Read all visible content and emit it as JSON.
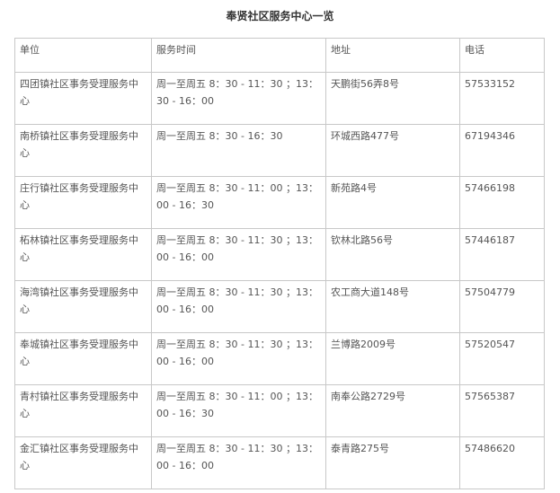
{
  "title": "奉贤社区服务中心一览",
  "columns": [
    "单位",
    "服务时间",
    "地址",
    "电话"
  ],
  "rows": [
    {
      "unit": "四团镇社区事务受理服务中心",
      "hours": "周一至周五 8：30 - 11：30 ；13：30 - 16：00",
      "address": "天鹏街56弄8号",
      "phone": "57533152"
    },
    {
      "unit": "南桥镇社区事务受理服务中心",
      "hours": "周一至周五 8：30 - 16：30",
      "address": "环城西路477号",
      "phone": "67194346"
    },
    {
      "unit": "庄行镇社区事务受理服务中心",
      "hours": "周一至周五 8：30 - 11：00 ；13：00 - 16：30",
      "address": "新苑路4号",
      "phone": "57466198"
    },
    {
      "unit": "柘林镇社区事务受理服务中心",
      "hours": "周一至周五 8：30 - 11：30 ；13：00 - 16：00",
      "address": "钦林北路56号",
      "phone": "57446187"
    },
    {
      "unit": "海湾镇社区事务受理服务中心",
      "hours": "周一至周五 8：30 - 11：30 ；13：00 - 16：00",
      "address": "农工商大道148号",
      "phone": "57504779"
    },
    {
      "unit": "奉城镇社区事务受理服务中心",
      "hours": "周一至周五 8：30 - 11：30 ；13：00 - 16：00",
      "address": "兰博路2009号",
      "phone": "57520547"
    },
    {
      "unit": "青村镇社区事务受理服务中心",
      "hours": "周一至周五 8：30 - 11：00 ；13：00 - 16：30",
      "address": "南奉公路2729号",
      "phone": "57565387"
    },
    {
      "unit": "金汇镇社区事务受理服务中心",
      "hours": "周一至周五 8：30 - 11：30 ；13：00 - 16：00",
      "address": "泰青路275号",
      "phone": "57486620"
    }
  ]
}
